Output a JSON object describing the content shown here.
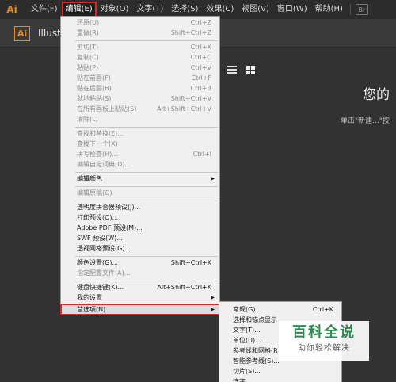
{
  "menubar": {
    "logo": "Ai",
    "items": [
      "文件(F)",
      "编辑(E)",
      "对象(O)",
      "文字(T)",
      "选择(S)",
      "效果(C)",
      "视图(V)",
      "窗口(W)",
      "帮助(H)"
    ],
    "bridge_label": "Br"
  },
  "app": {
    "logo": "Ai",
    "title": "Illust",
    "welcome_title": "您的",
    "welcome_subtitle": "单击\"新建...\"按"
  },
  "edit_menu": {
    "items": [
      {
        "label": "还原(U)",
        "shortcut": "Ctrl+Z",
        "disabled": true
      },
      {
        "label": "重做(R)",
        "shortcut": "Shift+Ctrl+Z",
        "disabled": true
      },
      {
        "label": "剪切(T)",
        "shortcut": "Ctrl+X",
        "disabled": true
      },
      {
        "label": "复制(C)",
        "shortcut": "Ctrl+C",
        "disabled": true
      },
      {
        "label": "粘贴(P)",
        "shortcut": "Ctrl+V",
        "disabled": true
      },
      {
        "label": "贴在前面(F)",
        "shortcut": "Ctrl+F",
        "disabled": true
      },
      {
        "label": "贴在后面(B)",
        "shortcut": "Ctrl+B",
        "disabled": true
      },
      {
        "label": "就地粘贴(S)",
        "shortcut": "Shift+Ctrl+V",
        "disabled": true
      },
      {
        "label": "在所有画板上粘贴(S)",
        "shortcut": "Alt+Shift+Ctrl+V",
        "disabled": true
      },
      {
        "label": "清除(L)",
        "shortcut": "",
        "disabled": true
      },
      {
        "label": "查找和替换(E)...",
        "shortcut": "",
        "disabled": true
      },
      {
        "label": "查找下一个(X)",
        "shortcut": "",
        "disabled": true
      },
      {
        "label": "拼写检查(H)...",
        "shortcut": "Ctrl+I",
        "disabled": true
      },
      {
        "label": "编辑自定词典(D)...",
        "shortcut": "",
        "disabled": true
      },
      {
        "label": "编辑颜色",
        "shortcut": "",
        "disabled": false,
        "submenu": true
      },
      {
        "label": "编辑原稿(O)",
        "shortcut": "",
        "disabled": true
      },
      {
        "label": "透明度拼合器预设(J)...",
        "shortcut": "",
        "disabled": false
      },
      {
        "label": "打印预设(Q)...",
        "shortcut": "",
        "disabled": false
      },
      {
        "label": "Adobe PDF 预设(M)...",
        "shortcut": "",
        "disabled": false
      },
      {
        "label": "SWF 预设(W)...",
        "shortcut": "",
        "disabled": false
      },
      {
        "label": "透视网格预设(G)...",
        "shortcut": "",
        "disabled": false
      },
      {
        "label": "颜色设置(G)...",
        "shortcut": "Shift+Ctrl+K",
        "disabled": false
      },
      {
        "label": "指定配置文件(A)...",
        "shortcut": "",
        "disabled": true
      },
      {
        "label": "键盘快捷键(K)...",
        "shortcut": "Alt+Shift+Ctrl+K",
        "disabled": false
      },
      {
        "label": "我的设置",
        "shortcut": "",
        "disabled": false,
        "submenu": true
      },
      {
        "label": "首选项(N)",
        "shortcut": "",
        "disabled": false,
        "submenu": true
      }
    ]
  },
  "preferences_submenu": {
    "items": [
      {
        "label": "常规(G)...",
        "shortcut": "Ctrl+K"
      },
      {
        "label": "选择和锚点显示",
        "shortcut": ""
      },
      {
        "label": "文字(T)...",
        "shortcut": ""
      },
      {
        "label": "单位(U)...",
        "shortcut": ""
      },
      {
        "label": "参考线和网格(R",
        "shortcut": ""
      },
      {
        "label": "智能参考线(S)...",
        "shortcut": ""
      },
      {
        "label": "切片(S)...",
        "shortcut": ""
      },
      {
        "label": "连字",
        "shortcut": ""
      }
    ]
  },
  "watermark": {
    "title": "百科全说",
    "subtitle": "助你轻松解决"
  },
  "colors": {
    "highlight": "#d42a2a",
    "ai_orange": "#e08a2c"
  }
}
